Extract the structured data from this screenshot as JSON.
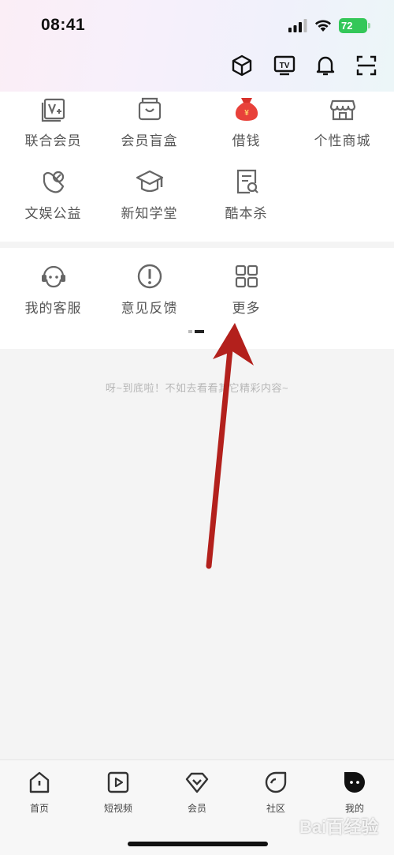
{
  "status_bar": {
    "time": "08:41",
    "battery": "72"
  },
  "grid_row1": [
    {
      "label": "联合会员",
      "icon": "vip-card-icon"
    },
    {
      "label": "会员盲盒",
      "icon": "blind-box-icon"
    },
    {
      "label": "借钱",
      "icon": "money-bag-icon"
    },
    {
      "label": "个性商城",
      "icon": "store-icon"
    }
  ],
  "grid_row2": [
    {
      "label": "文娱公益",
      "icon": "charity-icon"
    },
    {
      "label": "新知学堂",
      "icon": "graduation-cap-icon"
    },
    {
      "label": "酷本杀",
      "icon": "script-search-icon"
    }
  ],
  "grid_row3": [
    {
      "label": "我的客服",
      "icon": "customer-service-icon"
    },
    {
      "label": "意见反馈",
      "icon": "feedback-icon"
    },
    {
      "label": "更多",
      "icon": "more-grid-icon"
    }
  ],
  "bottom_message": "呀~到底啦！不如去看看其它精彩内容~",
  "tabbar": [
    {
      "label": "首页",
      "icon": "home-icon"
    },
    {
      "label": "短视频",
      "icon": "short-video-icon"
    },
    {
      "label": "会员",
      "icon": "vip-diamond-icon"
    },
    {
      "label": "社区",
      "icon": "community-icon"
    },
    {
      "label": "我的",
      "icon": "me-icon"
    }
  ],
  "watermark": "Bai百经验",
  "colors": {
    "accent_arrow": "#b3201c",
    "battery": "#34c759",
    "red_bag": "#e8413a"
  }
}
